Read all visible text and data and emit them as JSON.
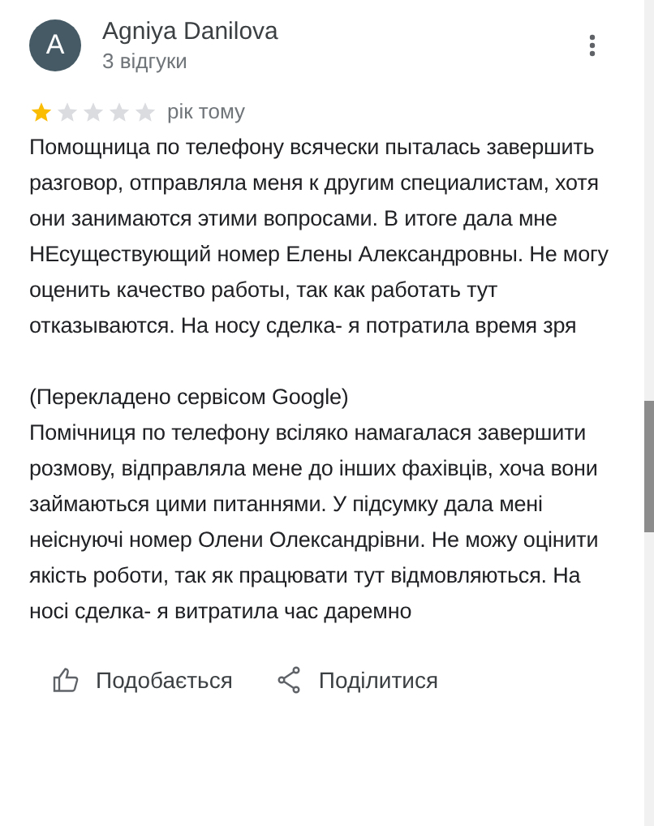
{
  "review": {
    "avatar_letter": "A",
    "author": "Agniya Danilova",
    "review_count": "3 відгуки",
    "stars": 1,
    "time": "рік тому",
    "text": "Помощница по телефону всячески пыталась завершить разговор, отправляла меня к другим специалистам, хотя они занимаются этими вопросами. В итоге дала мне НЕсуществующий номер Елены Александровны. Не могу оценить качество работы, так как работать тут отказываются. На носу сделка- я потратила время зря",
    "translation_note": "(Перекладено сервісом Google)",
    "translation": "Помічниця по телефону всіляко намагалася завершити розмову, відправляла мене до інших фахівців, хоча вони займаються цими питаннями. У підсумку дала мені неіснуючі номер Олени Олександрівни. Не можу оцінити якість роботи, так як працювати тут відмовляються. На носі сделка- я витратила час даремно"
  },
  "actions": [
    {
      "kind": "like",
      "label": "Подобається"
    },
    {
      "kind": "share",
      "label": "Поділитися"
    }
  ]
}
